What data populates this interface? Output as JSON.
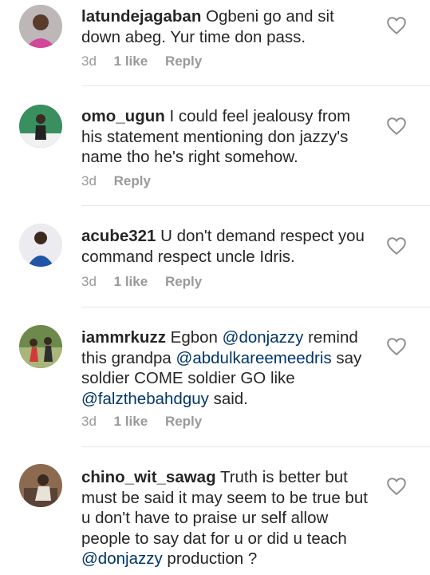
{
  "comments": [
    {
      "username": "latundejagaban",
      "segments": [
        {
          "text": "Ogbeni go and sit down abeg. Yur time don pass."
        }
      ],
      "time": "3d",
      "likes": "1 like",
      "reply": "Reply"
    },
    {
      "username": "omo_ugun",
      "segments": [
        {
          "text": "I could feel jealousy from his statement mentioning don jazzy's name tho he's right somehow."
        }
      ],
      "time": "3d",
      "likes": "",
      "reply": "Reply"
    },
    {
      "username": "acube321",
      "segments": [
        {
          "text": "U don't demand respect you command respect uncle Idris."
        }
      ],
      "time": "3d",
      "likes": "1 like",
      "reply": "Reply"
    },
    {
      "username": "iammrkuzz",
      "segments": [
        {
          "text": "Egbon "
        },
        {
          "text": "@donjazzy",
          "mention": true
        },
        {
          "text": " remind this grandpa  "
        },
        {
          "text": "@abdulkareemeedris",
          "mention": true
        },
        {
          "text": " say soldier COME  soldier GO like "
        },
        {
          "text": "@falzthebahdguy",
          "mention": true
        },
        {
          "text": " said."
        }
      ],
      "time": "3d",
      "likes": "1 like",
      "reply": "Reply"
    },
    {
      "username": "chino_wit_sawag",
      "segments": [
        {
          "text": "Truth is better but must be said it may seem to be true but u don't have to praise ur self allow people to say dat for u or did u teach "
        },
        {
          "text": "@donjazzy",
          "mention": true
        },
        {
          "text": " production ?"
        }
      ],
      "time": "",
      "likes": "",
      "reply": ""
    }
  ],
  "icons": {
    "like": "heart-outline-icon",
    "avatar": "user-avatar"
  },
  "colors": {
    "text": "#262626",
    "meta": "#999999",
    "mention": "#003569",
    "divider": "#e6e6e6"
  }
}
